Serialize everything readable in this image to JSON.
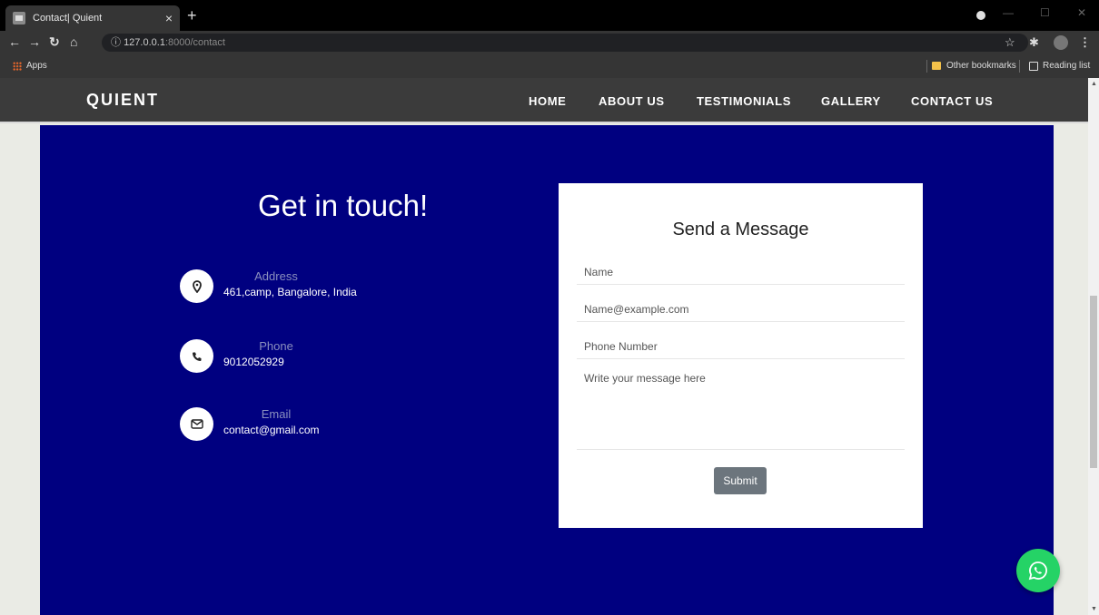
{
  "browser": {
    "tab_title": "Contact| Quient",
    "tab_close": "×",
    "new_tab": "+",
    "url_host": "127.0.0.1",
    "url_path": ":8000/contact",
    "bookmarks": {
      "apps": "Apps",
      "other": "Other bookmarks",
      "reading": "Reading list"
    }
  },
  "site": {
    "brand": "QUIENT",
    "nav": [
      "HOME",
      "ABOUT US",
      "TESTIMONIALS",
      "GALLERY",
      "CONTACT US"
    ]
  },
  "contact": {
    "heading": "Get in touch!",
    "address_label": "Address",
    "address_value": "461,camp, Bangalore, India",
    "phone_label": "Phone",
    "phone_value": "9012052929",
    "email_label": "Email",
    "email_value": "contact@gmail.com"
  },
  "form": {
    "title": "Send a Message",
    "name_placeholder": "Name",
    "email_placeholder": "Name@example.com",
    "phone_placeholder": "Phone Number",
    "message_placeholder": "Write your message here",
    "submit_label": "Submit"
  },
  "colors": {
    "section_bg": "#000080",
    "header_bg": "#3b3b3b",
    "submit_bg": "#6c757d",
    "whatsapp": "#25d366"
  }
}
